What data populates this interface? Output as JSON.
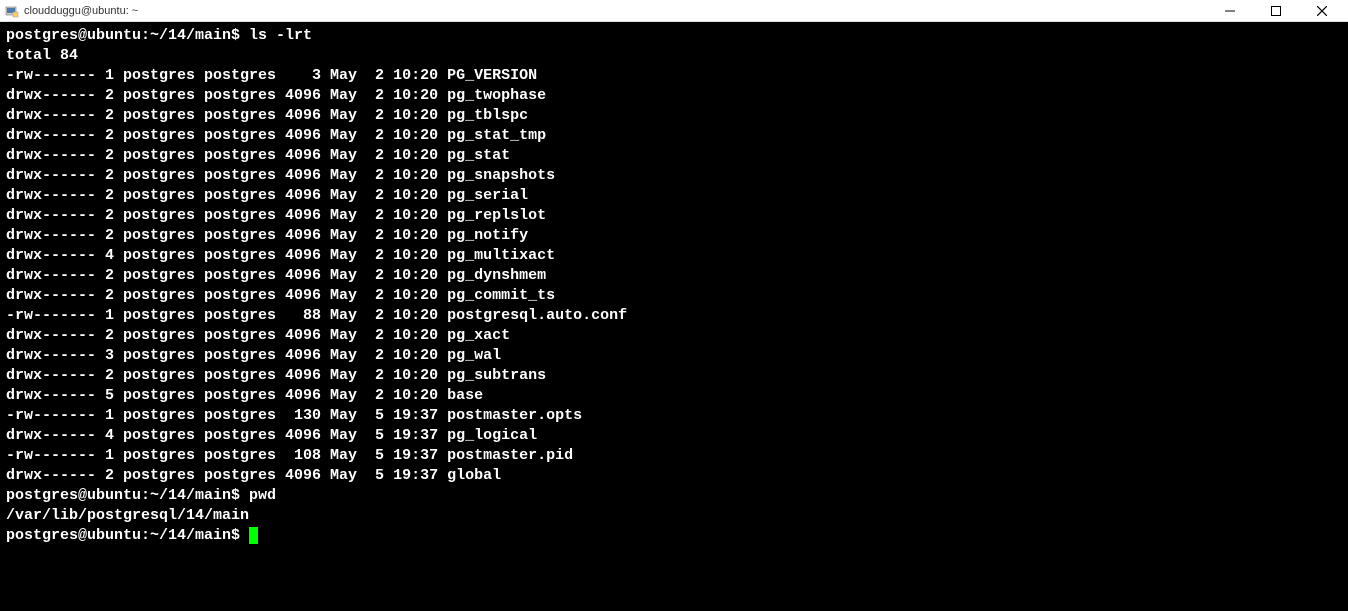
{
  "window": {
    "title": "cloudduggu@ubuntu: ~"
  },
  "terminal": {
    "prompt1": "postgres@ubuntu:~/14/main$ ",
    "command1": "ls -lrt",
    "total_line": "total 84",
    "listing": [
      "-rw------- 1 postgres postgres    3 May  2 10:20 PG_VERSION",
      "drwx------ 2 postgres postgres 4096 May  2 10:20 pg_twophase",
      "drwx------ 2 postgres postgres 4096 May  2 10:20 pg_tblspc",
      "drwx------ 2 postgres postgres 4096 May  2 10:20 pg_stat_tmp",
      "drwx------ 2 postgres postgres 4096 May  2 10:20 pg_stat",
      "drwx------ 2 postgres postgres 4096 May  2 10:20 pg_snapshots",
      "drwx------ 2 postgres postgres 4096 May  2 10:20 pg_serial",
      "drwx------ 2 postgres postgres 4096 May  2 10:20 pg_replslot",
      "drwx------ 2 postgres postgres 4096 May  2 10:20 pg_notify",
      "drwx------ 4 postgres postgres 4096 May  2 10:20 pg_multixact",
      "drwx------ 2 postgres postgres 4096 May  2 10:20 pg_dynshmem",
      "drwx------ 2 postgres postgres 4096 May  2 10:20 pg_commit_ts",
      "-rw------- 1 postgres postgres   88 May  2 10:20 postgresql.auto.conf",
      "drwx------ 2 postgres postgres 4096 May  2 10:20 pg_xact",
      "drwx------ 3 postgres postgres 4096 May  2 10:20 pg_wal",
      "drwx------ 2 postgres postgres 4096 May  2 10:20 pg_subtrans",
      "drwx------ 5 postgres postgres 4096 May  2 10:20 base",
      "-rw------- 1 postgres postgres  130 May  5 19:37 postmaster.opts",
      "drwx------ 4 postgres postgres 4096 May  5 19:37 pg_logical",
      "-rw------- 1 postgres postgres  108 May  5 19:37 postmaster.pid",
      "drwx------ 2 postgres postgres 4096 May  5 19:37 global"
    ],
    "prompt2": "postgres@ubuntu:~/14/main$ ",
    "command2": "pwd",
    "pwd_output": "/var/lib/postgresql/14/main",
    "prompt3": "postgres@ubuntu:~/14/main$ "
  }
}
